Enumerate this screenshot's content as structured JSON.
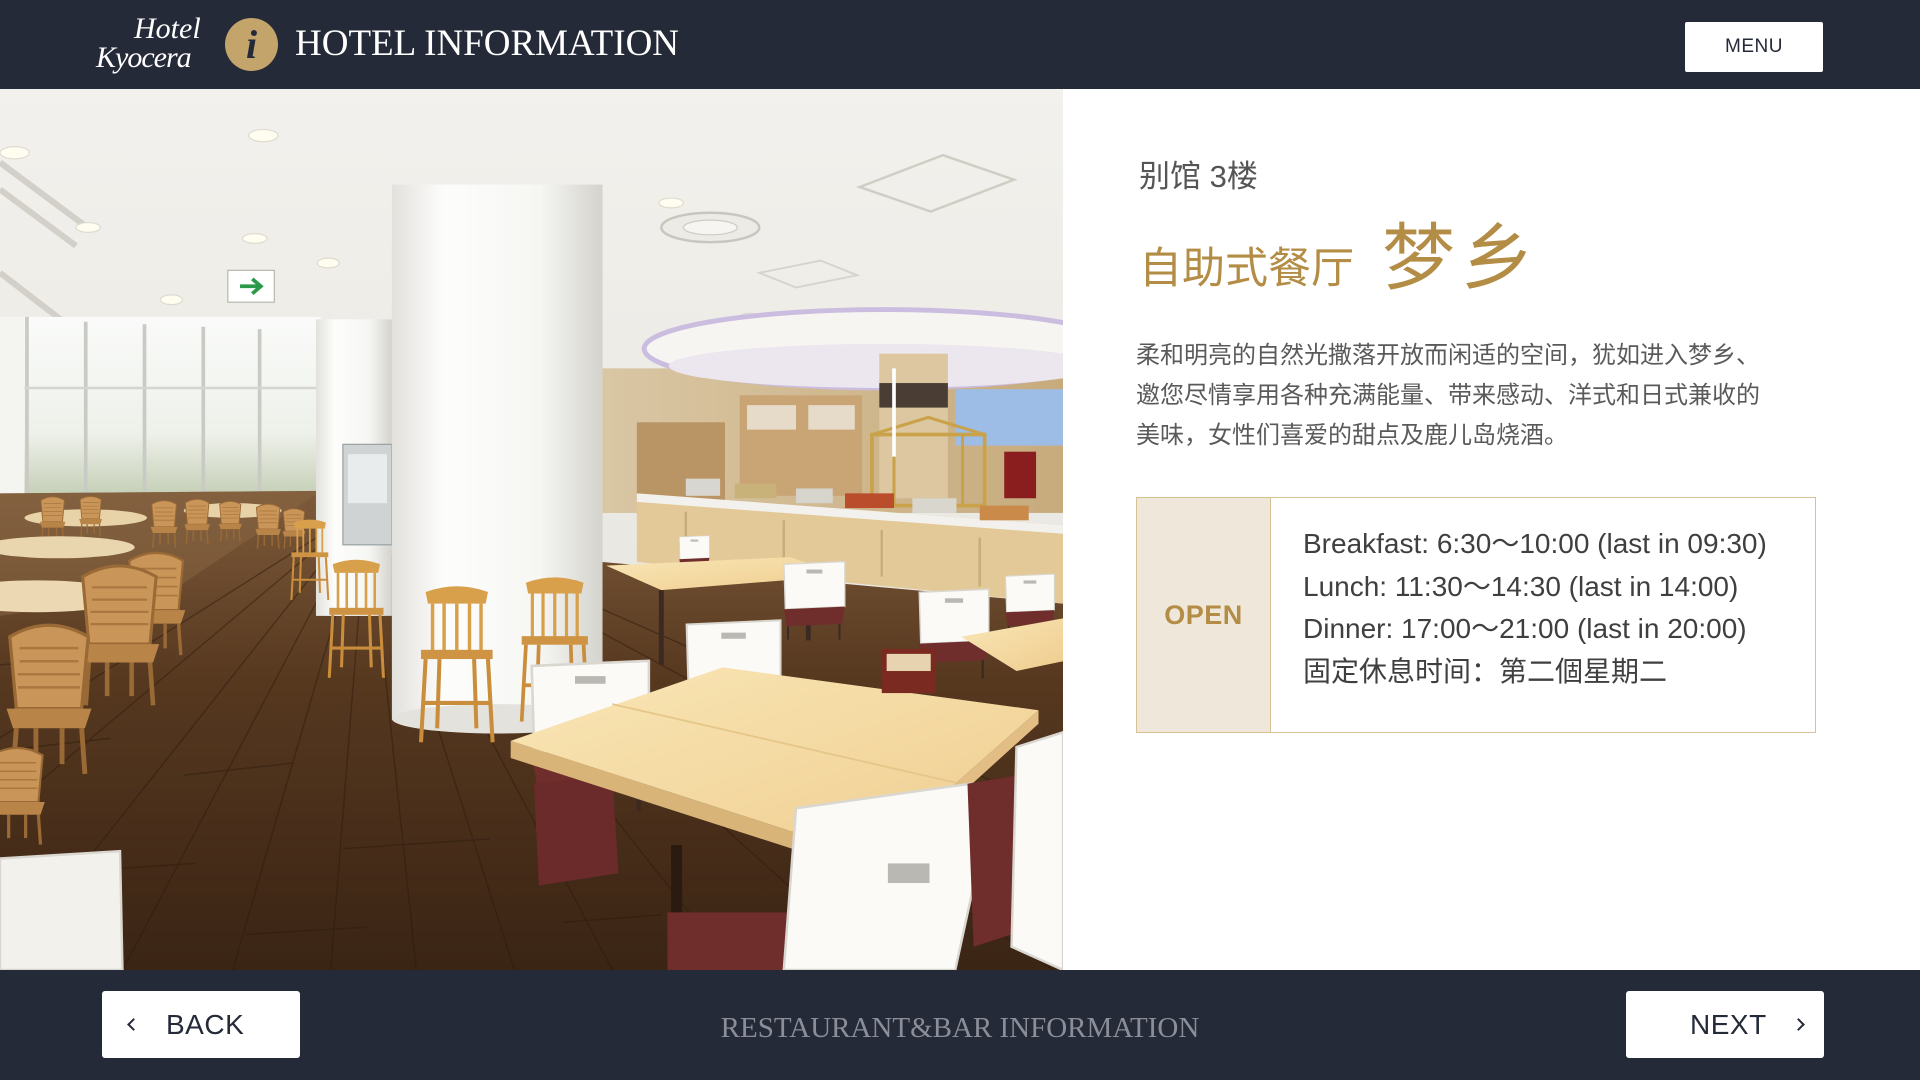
{
  "header": {
    "logo": {
      "line1": "Hotel",
      "line2": "Kyocera"
    },
    "info_icon": "info-icon",
    "title": "HOTEL INFORMATION",
    "menu_label": "MENU"
  },
  "restaurant": {
    "location": "别馆 3楼",
    "category": "自助式餐厅",
    "name": "梦乡",
    "description_lines": [
      "柔和明亮的自然光撒落开放而闲适的空间，犹如进入梦乡、",
      "邀您尽情享用各种充满能量、带来感动、洋式和日式兼收的",
      "美味，女性们喜爱的甜点及鹿儿岛烧酒。"
    ],
    "open_label": "OPEN",
    "hours": [
      "Breakfast: 6:30～10:00 (last in 09:30)",
      "Lunch: 11:30～14:30 (last in 14:00)",
      "Dinner: 17:00～21:00 (last in 20:00)",
      "固定休息时间：第二個星期二"
    ]
  },
  "footer": {
    "back_icon": "chevron-left-icon",
    "back_label": "BACK",
    "section_title": "RESTAURANT&BAR INFORMATION",
    "next_label": "NEXT",
    "next_icon": "chevron-right-icon"
  },
  "colors": {
    "navy": "#252a38",
    "gold": "#b38d45",
    "icongold": "#c3a46a",
    "cell": "#efe7da",
    "boxline": "#d6c296",
    "text": "#5a5a5a",
    "hours": "#3f3f3f",
    "foot": "#8b8e98"
  }
}
